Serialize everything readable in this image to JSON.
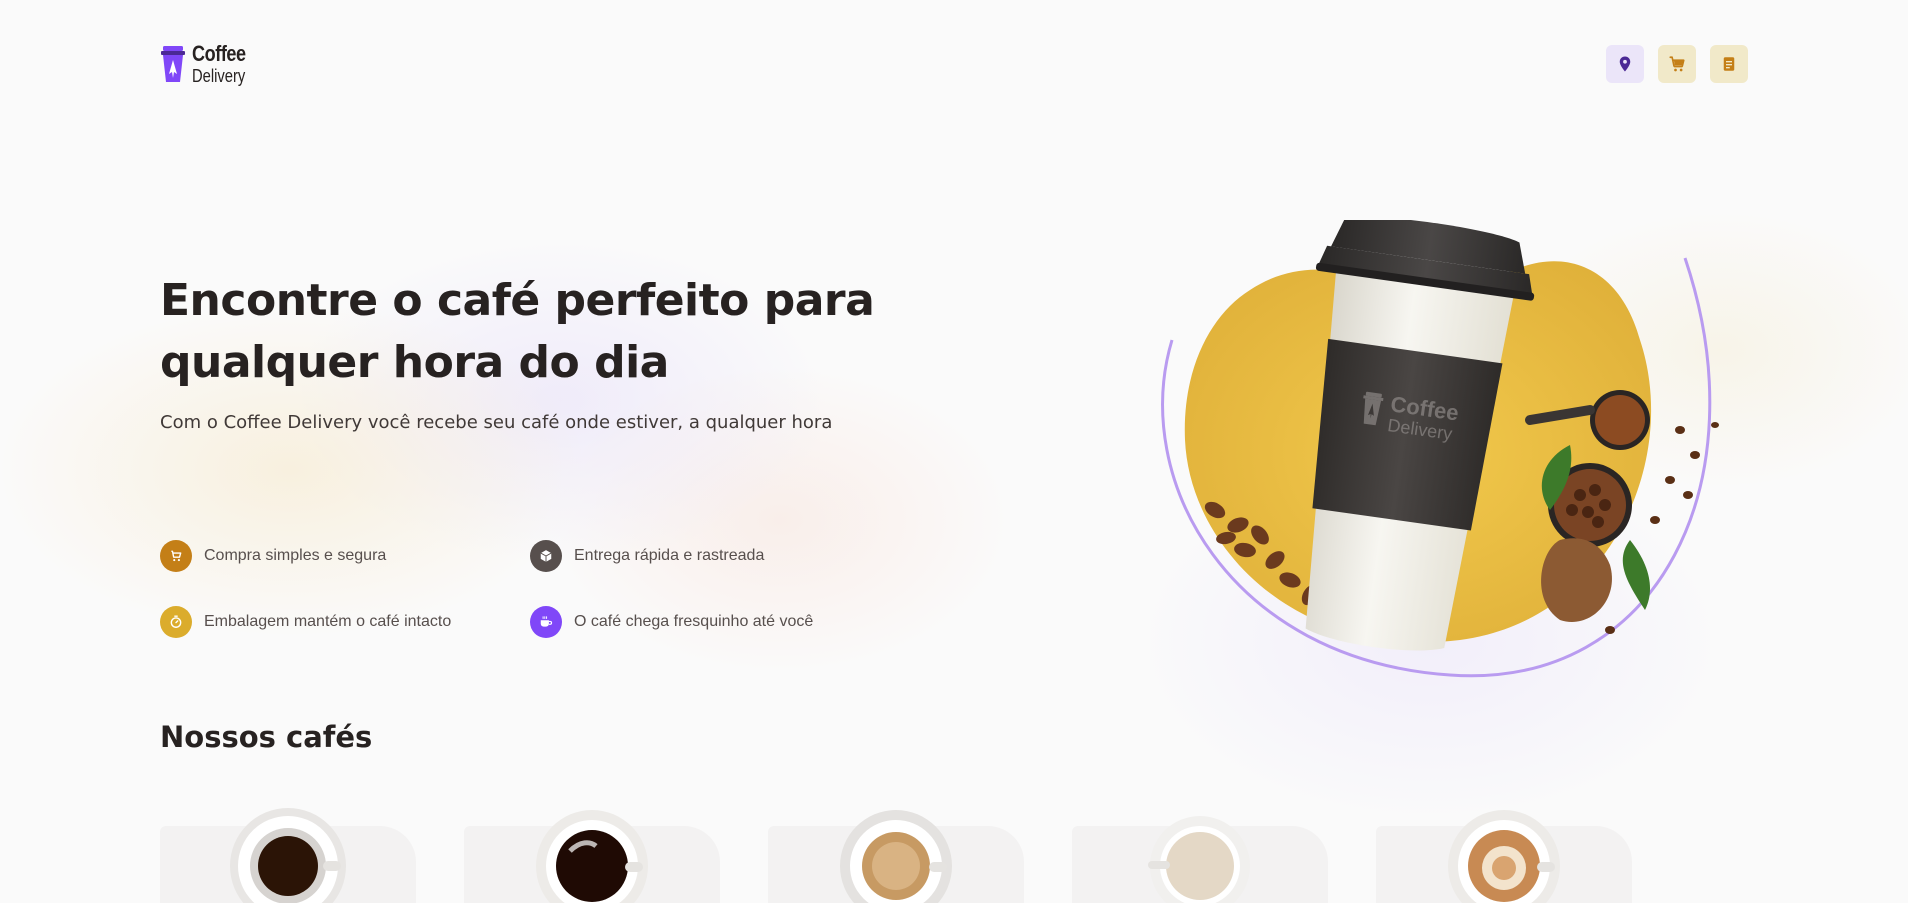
{
  "brand": {
    "line1": "Coffee",
    "line2": "Delivery"
  },
  "header": {
    "actions": [
      {
        "name": "location",
        "icon": "map-pin-icon"
      },
      {
        "name": "cart",
        "icon": "shopping-cart-icon"
      },
      {
        "name": "orders",
        "icon": "receipt-icon"
      }
    ]
  },
  "hero": {
    "title": "Encontre o café perfeito para qualquer hora do dia",
    "subtitle": "Com o Coffee Delivery você recebe seu café onde estiver, a qualquer hora"
  },
  "features": [
    {
      "text": "Compra simples e segura",
      "icon": "shopping-cart-icon",
      "color": "#C47F17"
    },
    {
      "text": "Entrega rápida e rastreada",
      "icon": "package-icon",
      "color": "#574F4D"
    },
    {
      "text": "Embalagem mantém o café intacto",
      "icon": "timer-icon",
      "color": "#DBAC2C"
    },
    {
      "text": "O café chega fresquinho até você",
      "icon": "coffee-icon",
      "color": "#8047F8"
    }
  ],
  "section": {
    "title": "Nossos cafés"
  },
  "colors": {
    "purple": "#8047F8",
    "purple_dark": "#4B2995",
    "purple_light": "#EBE5F9",
    "yellow": "#DBAC2C",
    "yellow_dark": "#C47F17",
    "yellow_light": "#F1E9C9"
  },
  "products": [
    {
      "icon": "espresso-cup-icon"
    },
    {
      "icon": "americano-cup-icon"
    },
    {
      "icon": "creamy-espresso-cup-icon"
    },
    {
      "icon": "iced-coffee-cup-icon"
    },
    {
      "icon": "latte-cup-icon"
    }
  ]
}
